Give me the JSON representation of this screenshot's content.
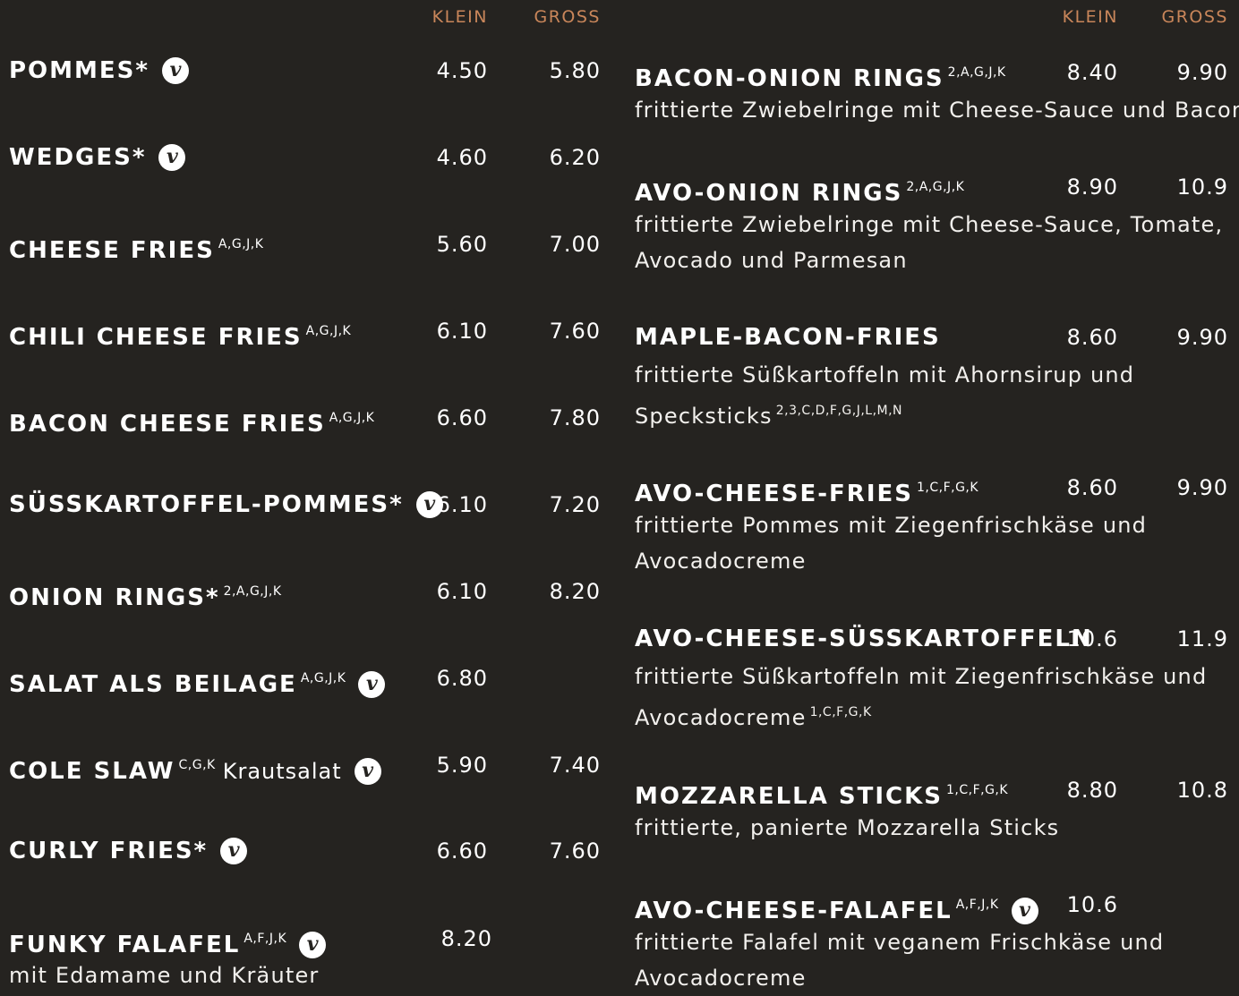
{
  "header": {
    "klein": "KLEIN",
    "gross": "GROSS"
  },
  "left": [
    {
      "name": "POMMES*",
      "sup": "",
      "extra": "",
      "veg": true,
      "klein": "4.50",
      "gross": "5.80"
    },
    {
      "name": "WEDGES*",
      "sup": "",
      "extra": "",
      "veg": true,
      "klein": "4.60",
      "gross": "6.20"
    },
    {
      "name": "CHEESE FRIES",
      "sup": "A,G,J,K",
      "extra": "",
      "veg": false,
      "klein": "5.60",
      "gross": "7.00"
    },
    {
      "name": "CHILI CHEESE FRIES",
      "sup": "A,G,J,K",
      "extra": "",
      "veg": false,
      "klein": "6.10",
      "gross": "7.60"
    },
    {
      "name": "BACON CHEESE FRIES",
      "sup": "A,G,J,K",
      "extra": "",
      "veg": false,
      "klein": "6.60",
      "gross": "7.80"
    },
    {
      "name": "SÜSSKARTOFFEL-POMMES*",
      "sup": "",
      "extra": "",
      "veg": true,
      "klein": "6.10",
      "gross": "7.20"
    },
    {
      "name": "ONION RINGS*",
      "sup": "2,A,G,J,K",
      "extra": "",
      "veg": false,
      "klein": "6.10",
      "gross": "8.20"
    },
    {
      "name": "SALAT ALS BEILAGE",
      "sup": "A,G,J,K",
      "extra": "",
      "veg": true,
      "klein": "6.80",
      "gross": ""
    },
    {
      "name": "COLE SLAW",
      "sup": "C,G,K",
      "extra": "Krautsalat",
      "veg": true,
      "klein": "5.90",
      "gross": "7.40"
    },
    {
      "name": "CURLY FRIES*",
      "sup": "",
      "extra": "",
      "veg": true,
      "klein": "6.60",
      "gross": "7.60"
    },
    {
      "name": "FUNKY FALAFEL",
      "sup": "A,F,J,K",
      "extra": "",
      "veg": true,
      "klein": "8.20",
      "gross": "",
      "desc": "mit Edamame und Kräuter"
    }
  ],
  "right": [
    {
      "name": "BACON-ONION RINGS",
      "sup": "2,A,G,J,K",
      "veg": false,
      "klein": "8.40",
      "gross": "9.90",
      "desc1": "frittierte Zwiebelringe mit Cheese-Sauce und Bacon",
      "desc2": "",
      "desc2sup": ""
    },
    {
      "name": "AVO-ONION RINGS",
      "sup": "2,A,G,J,K",
      "veg": false,
      "klein": "8.90",
      "gross": "10.9",
      "desc1": "frittierte Zwiebelringe mit Cheese-Sauce, Tomate,",
      "desc2": "Avocado und Parmesan",
      "desc2sup": ""
    },
    {
      "name": "MAPLE-BACON-FRIES",
      "sup": "",
      "veg": false,
      "klein": "8.60",
      "gross": "9.90",
      "desc1": "frittierte Süßkartoffeln mit Ahornsirup und",
      "desc2": "Specksticks",
      "desc2sup": "2,3,C,D,F,G,J,L,M,N"
    },
    {
      "name": "AVO-CHEESE-FRIES",
      "sup": "1,C,F,G,K",
      "veg": false,
      "klein": "8.60",
      "gross": "9.90",
      "desc1": "frittierte Pommes mit Ziegenfrischkäse und",
      "desc2": "Avocadocreme",
      "desc2sup": ""
    },
    {
      "name": "AVO-CHEESE-SÜSSKARTOFFELN",
      "sup": "",
      "veg": false,
      "klein": "10.6",
      "gross": "11.9",
      "desc1": "frittierte Süßkartoffeln mit Ziegenfrischkäse und",
      "desc2": "Avocadocreme",
      "desc2sup": "1,C,F,G,K"
    },
    {
      "name": "MOZZARELLA STICKS",
      "sup": "1,C,F,G,K",
      "veg": false,
      "klein": "8.80",
      "gross": "10.8",
      "desc1": "frittierte, panierte Mozzarella Sticks",
      "desc2": "",
      "desc2sup": ""
    },
    {
      "name": "AVO-CHEESE-FALAFEL",
      "sup": "A,F,J,K",
      "veg": true,
      "klein": "10.6",
      "gross": "",
      "desc1": "frittierte Falafel mit veganem Frischkäse und",
      "desc2": "Avocadocreme",
      "desc2sup": ""
    }
  ],
  "veg_icon": {
    "glyph": "v",
    "name": "vegan-icon",
    "bg": "#ffffff",
    "fg": "#252320"
  },
  "colors": {
    "background": "#252320",
    "header": "#c9865a",
    "text": "#ffffff"
  }
}
